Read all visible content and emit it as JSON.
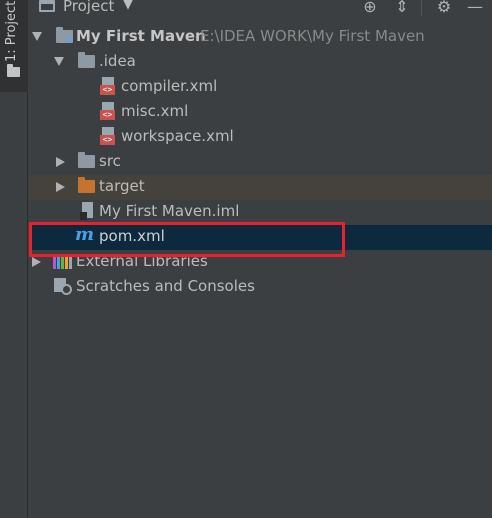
{
  "stripe": {
    "label": "1: Project"
  },
  "header": {
    "title": "Project",
    "caret": "▼",
    "tools": {
      "locate": "⊕",
      "collapse": "⇕",
      "settings": "⚙",
      "hide": "—"
    }
  },
  "tree": {
    "root": {
      "name": "My First Maven",
      "path": "E:\\IDEA WORK\\My First Maven"
    },
    "idea": {
      "name": ".idea"
    },
    "idea_files": [
      "compiler.xml",
      "misc.xml",
      "workspace.xml"
    ],
    "src": "src",
    "target": "target",
    "iml": "My First Maven.iml",
    "pom": "pom.xml",
    "ext_libs": "External Libraries",
    "scratches": "Scratches and Consoles"
  },
  "icons": {
    "xml_tag": "<>",
    "maven_letter": "m"
  },
  "colors": {
    "selection": "#0d293e",
    "highlight_box": "#e8212c",
    "excluded_row": "#45423b"
  }
}
